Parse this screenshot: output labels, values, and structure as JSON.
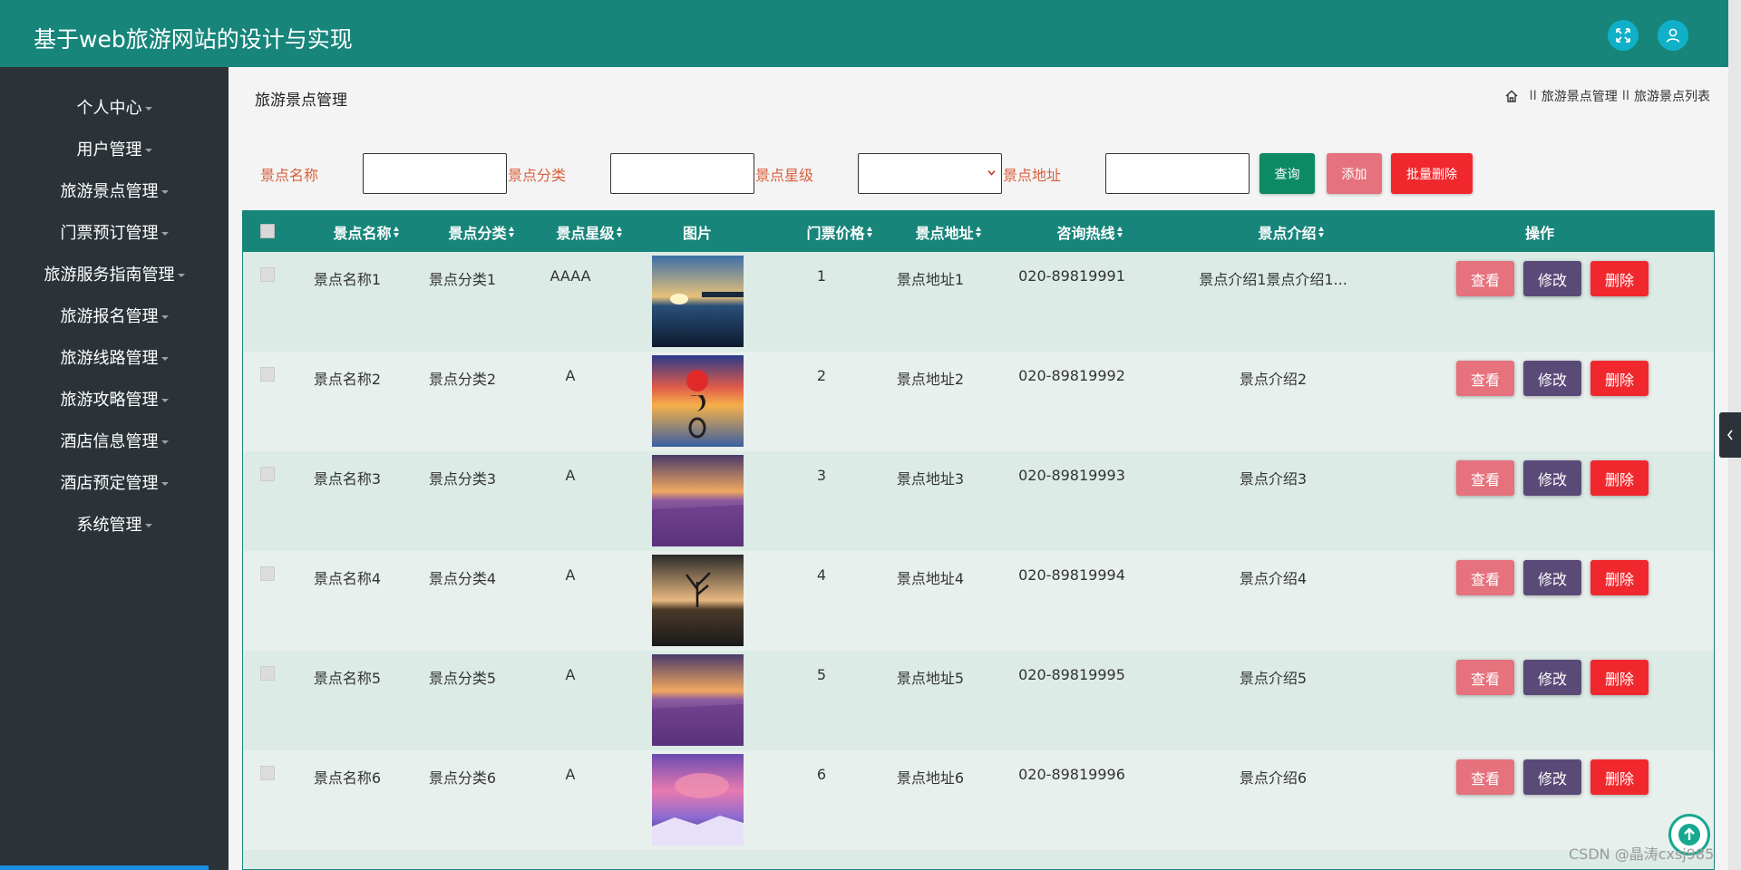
{
  "header": {
    "title": "基于web旅游网站的设计与实现",
    "colors": {
      "bar": "#17857a",
      "icon_button": "#0fb0c8"
    },
    "fullscreen_icon": "expand-icon",
    "user_icon": "user-icon"
  },
  "sidebar": {
    "items": [
      {
        "label": "个人中心"
      },
      {
        "label": "用户管理"
      },
      {
        "label": "旅游景点管理"
      },
      {
        "label": "门票预订管理"
      },
      {
        "label": "旅游服务指南管理"
      },
      {
        "label": "旅游报名管理"
      },
      {
        "label": "旅游线路管理"
      },
      {
        "label": "旅游攻略管理"
      },
      {
        "label": "酒店信息管理"
      },
      {
        "label": "酒店预定管理"
      },
      {
        "label": "系统管理"
      }
    ]
  },
  "page": {
    "title": "旅游景点管理",
    "breadcrumb": [
      "旅游景点管理",
      "旅游景点列表"
    ],
    "breadcrumb_sep": "II"
  },
  "filters": {
    "name_label": "景点名称",
    "name_value": "",
    "category_label": "景点分类",
    "category_value": "",
    "star_label": "景点星级",
    "star_value": "",
    "address_label": "景点地址",
    "address_value": "",
    "search_button": "查询",
    "add_button": "添加",
    "batch_delete_button": "批量删除"
  },
  "table": {
    "headers": {
      "name": "景点名称",
      "category": "景点分类",
      "star": "景点星级",
      "image": "图片",
      "price": "门票价格",
      "address": "景点地址",
      "hotline": "咨询热线",
      "intro": "景点介绍",
      "actions": "操作"
    },
    "rows": [
      {
        "name": "景点名称1",
        "category": "景点分类1",
        "star": "AAAA",
        "price": "1",
        "address": "景点地址1",
        "hotline": "020-89819991",
        "intro": "景点介绍1景点介绍1..."
      },
      {
        "name": "景点名称2",
        "category": "景点分类2",
        "star": "A",
        "price": "2",
        "address": "景点地址2",
        "hotline": "020-89819992",
        "intro": "景点介绍2"
      },
      {
        "name": "景点名称3",
        "category": "景点分类3",
        "star": "A",
        "price": "3",
        "address": "景点地址3",
        "hotline": "020-89819993",
        "intro": "景点介绍3"
      },
      {
        "name": "景点名称4",
        "category": "景点分类4",
        "star": "A",
        "price": "4",
        "address": "景点地址4",
        "hotline": "020-89819994",
        "intro": "景点介绍4"
      },
      {
        "name": "景点名称5",
        "category": "景点分类5",
        "star": "A",
        "price": "5",
        "address": "景点地址5",
        "hotline": "020-89819995",
        "intro": "景点介绍5"
      },
      {
        "name": "景点名称6",
        "category": "景点分类6",
        "star": "A",
        "price": "6",
        "address": "景点地址6",
        "hotline": "020-89819996",
        "intro": "景点介绍6"
      }
    ],
    "view_button": "查看",
    "edit_button": "修改",
    "delete_button": "删除"
  },
  "watermark": "CSDN @晶涛cxsj985"
}
